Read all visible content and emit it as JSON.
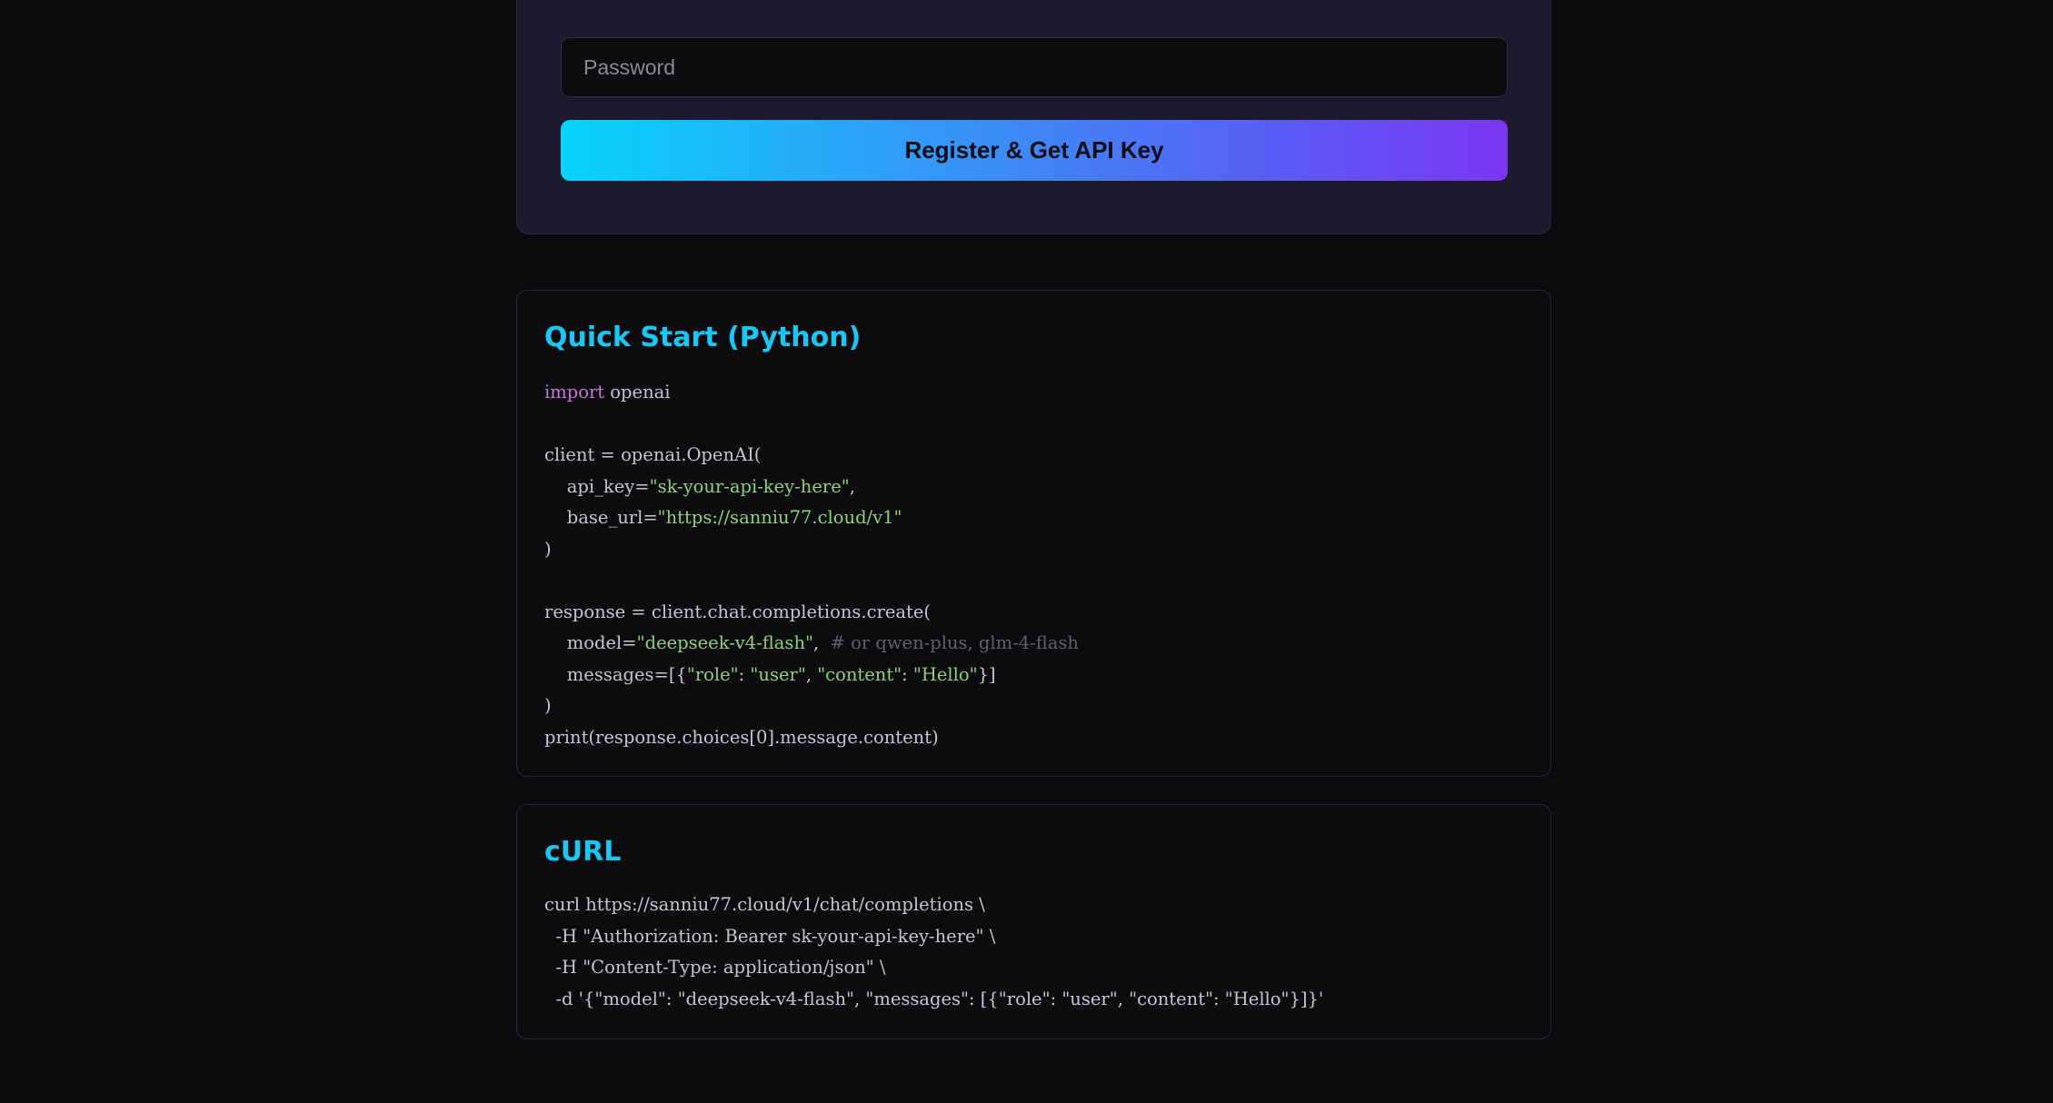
{
  "register": {
    "password_placeholder": "Password",
    "button_label": "Register & Get API Key"
  },
  "python": {
    "title": "Quick Start (Python)",
    "lines": [
      {
        "parts": [
          {
            "t": "import",
            "c": "kw"
          },
          {
            "t": " openai",
            "c": ""
          }
        ]
      },
      {
        "parts": []
      },
      {
        "parts": [
          {
            "t": "client = openai.OpenAI(",
            "c": ""
          }
        ]
      },
      {
        "parts": [
          {
            "t": "    api_key=",
            "c": ""
          },
          {
            "t": "\"sk-your-api-key-here\"",
            "c": "str"
          },
          {
            "t": ",",
            "c": ""
          }
        ]
      },
      {
        "parts": [
          {
            "t": "    base_url=",
            "c": ""
          },
          {
            "t": "\"https://sanniu77.cloud/v1\"",
            "c": "str"
          }
        ]
      },
      {
        "parts": [
          {
            "t": ")",
            "c": ""
          }
        ]
      },
      {
        "parts": []
      },
      {
        "parts": [
          {
            "t": "response = client.chat.completions.create(",
            "c": ""
          }
        ]
      },
      {
        "parts": [
          {
            "t": "    model=",
            "c": ""
          },
          {
            "t": "\"deepseek-v4-flash\"",
            "c": "str"
          },
          {
            "t": ",  ",
            "c": ""
          },
          {
            "t": "# or qwen-plus, glm-4-flash",
            "c": "cmt"
          }
        ]
      },
      {
        "parts": [
          {
            "t": "    messages=[{",
            "c": ""
          },
          {
            "t": "\"role\"",
            "c": "str"
          },
          {
            "t": ": ",
            "c": ""
          },
          {
            "t": "\"user\"",
            "c": "str"
          },
          {
            "t": ", ",
            "c": ""
          },
          {
            "t": "\"content\"",
            "c": "str"
          },
          {
            "t": ": ",
            "c": ""
          },
          {
            "t": "\"Hello\"",
            "c": "str"
          },
          {
            "t": "}]",
            "c": ""
          }
        ]
      },
      {
        "parts": [
          {
            "t": ")",
            "c": ""
          }
        ]
      },
      {
        "parts": [
          {
            "t": "print(response.choices[0].message.content)",
            "c": ""
          }
        ]
      }
    ]
  },
  "curl": {
    "title": "cURL",
    "lines": [
      {
        "parts": [
          {
            "t": "curl https://sanniu77.cloud/v1/chat/completions \\",
            "c": ""
          }
        ]
      },
      {
        "parts": [
          {
            "t": "  -H \"Authorization: Bearer sk-your-api-key-here\" \\",
            "c": ""
          }
        ]
      },
      {
        "parts": [
          {
            "t": "  -H \"Content-Type: application/json\" \\",
            "c": ""
          }
        ]
      },
      {
        "parts": [
          {
            "t": "  -d '{\"model\": \"deepseek-v4-flash\", \"messages\": [{\"role\": \"user\", \"content\": \"Hello\"}]}'",
            "c": ""
          }
        ]
      }
    ]
  }
}
